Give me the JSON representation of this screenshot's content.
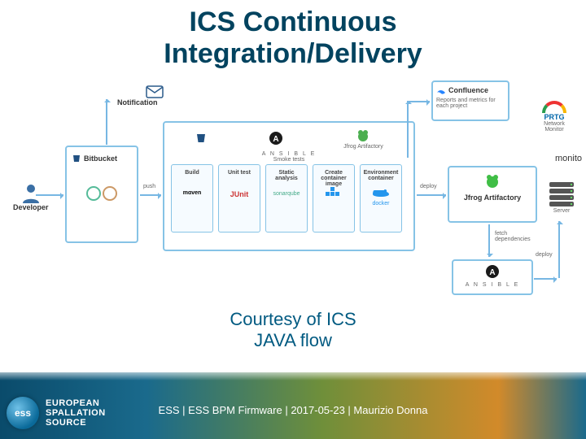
{
  "title_line1": "ICS Continuous",
  "title_line2": "Integration/Delivery",
  "courtesy_line1": "Courtesy of ICS",
  "courtesy_line2": "JAVA flow",
  "labels": {
    "developer": "Developer",
    "notification": "Notification",
    "confluence": "Confluence",
    "bitbucket": "Bitbucket",
    "ansible": "A N S I B L E",
    "artifactory": "Jfrog Artifactory",
    "prtg": "PRTG",
    "prtg_sub": "Network Monitor",
    "monitor": "monito",
    "server": "Server",
    "reports_metrics": "Reports and metrics for each project",
    "smoke_tests": "Smoke tests",
    "push": "push",
    "build": "Build",
    "maven": "mɑven",
    "unit_test": "Unit test",
    "junit": "JUnit",
    "static": "Static analysis",
    "sonarqube": "sonarqube",
    "create_image": "Create container image",
    "environment": "Environment container",
    "docker": "docker",
    "deploy": "deploy",
    "fetch": "fetch dependencies",
    "deploy2": "deploy"
  },
  "footer": {
    "logo_text": "ess",
    "org_l1": "EUROPEAN",
    "org_l2": "SPALLATION",
    "org_l3": "SOURCE",
    "text": "ESS |  ESS BPM Firmware |  2017-05-23 |   Maurizio Donna"
  }
}
